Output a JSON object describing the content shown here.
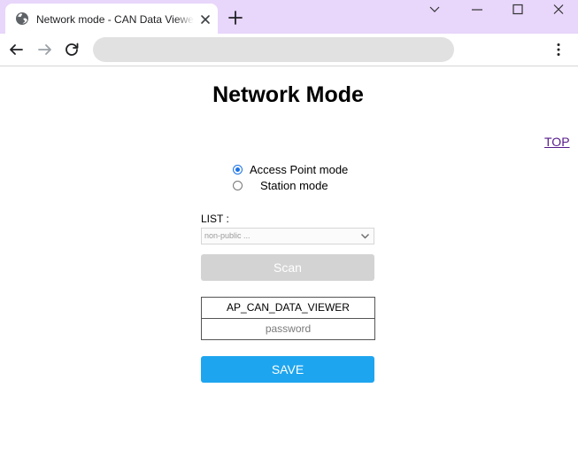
{
  "browser": {
    "tab_title": "Network mode - CAN Data Viewer",
    "favicon_icon": "globe-icon",
    "close_icon": "close-icon",
    "new_tab_icon": "plus-icon",
    "window_controls": [
      "chevron-down-icon",
      "minimize-icon",
      "maximize-icon",
      "close-icon"
    ],
    "nav_icons": [
      "back-arrow-icon",
      "forward-arrow-icon",
      "reload-icon",
      "kebab-menu-icon"
    ],
    "address": ""
  },
  "page": {
    "title": "Network Mode",
    "top_link": "TOP",
    "mode_options": [
      {
        "label": "Access Point mode",
        "checked": true
      },
      {
        "label": "Station mode",
        "checked": false
      }
    ],
    "list_label": "LIST :",
    "list_selected": "non-public ...",
    "scan_label": "Scan",
    "ssid_value": "AP_CAN_DATA_VIEWER",
    "password_placeholder": "password",
    "save_label": "SAVE"
  },
  "colors": {
    "titlebar": "#e8d6fb",
    "save_button": "#1ea5ef",
    "scan_button_disabled": "#d3d3d3",
    "link": "#551a8b",
    "radio_accent": "#1a73e8"
  }
}
